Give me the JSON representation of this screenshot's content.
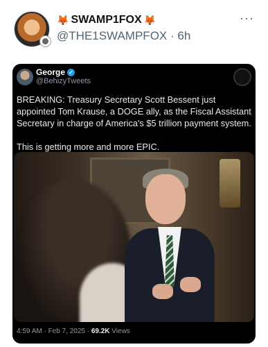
{
  "post": {
    "author_name": "SWAMP1FOX",
    "handle_time": "@THE1SWAMPFOX · 6h",
    "more_icon": "more-dots-icon",
    "emoji_left": "🦊",
    "emoji_right": "🦊"
  },
  "quoted": {
    "name": "George",
    "handle": "@BehizyTweets",
    "text_1": "BREAKING: Treasury Secretary Scott Bessent just appointed Tom Krause, a DOGE ally, as the Fiscal Assistant Secretary in charge of America's $5 trillion payment system.",
    "text_2": "This is getting more and more EPIC.",
    "timestamp": "4:59 AM · Feb 7, 2025 · ",
    "views_count": "69.2K",
    "views_label": " Views",
    "verified_icon": "verified-badge-icon",
    "colors": {
      "verified": "#1d9bf0",
      "background": "#000000"
    }
  }
}
